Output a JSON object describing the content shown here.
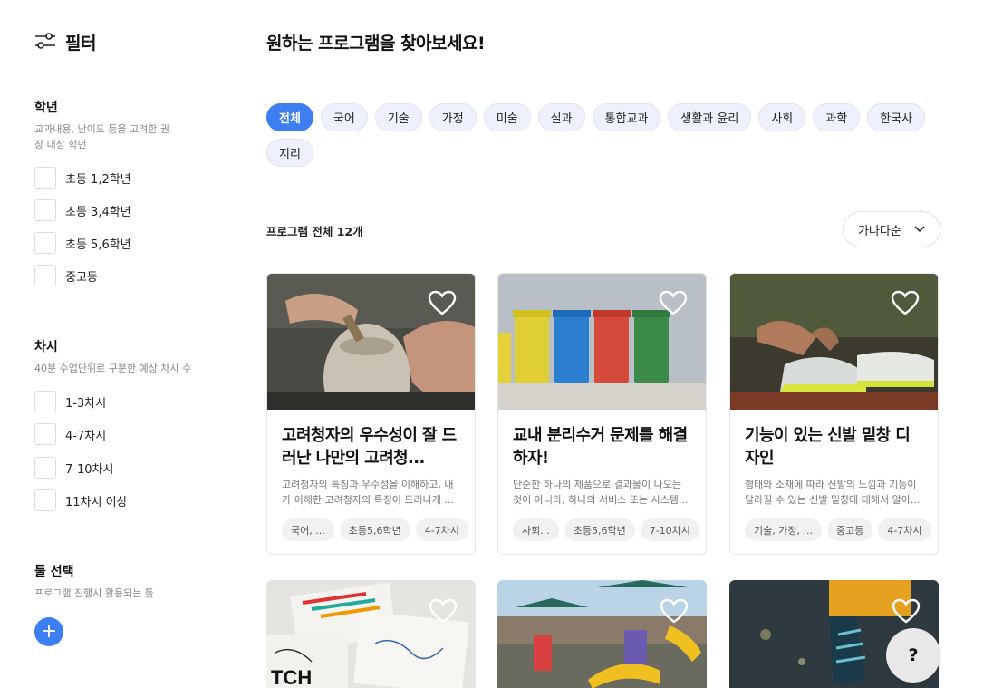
{
  "sidebar": {
    "title": "필터",
    "sections": [
      {
        "title": "학년",
        "desc": "교과내용, 난이도 등을 고려한 권장 대상 학년",
        "options": [
          "초등 1,2학년",
          "초등 3,4학년",
          "초등 5,6학년",
          "중고등"
        ]
      },
      {
        "title": "차시",
        "desc": "40분 수업단위로 구분한 예상 차시 수",
        "options": [
          "1-3차시",
          "4-7차시",
          "7-10차시",
          "11차시 이상"
        ]
      },
      {
        "title": "툴 선택",
        "desc": "프로그램 진행시 활용되는 툴",
        "options": []
      }
    ],
    "add_label": "+"
  },
  "main": {
    "title": "원하는 프로그램을 찾아보세요!",
    "chips": [
      "전체",
      "국어",
      "기술",
      "가정",
      "미술",
      "실과",
      "통합교과",
      "생활과 윤리",
      "사회",
      "과학",
      "한국사",
      "지리"
    ],
    "active_chip": "전체",
    "count_label": "프로그램 전체 12개",
    "sort_label": "가나다순",
    "cards": [
      {
        "title": "고려청자의 우수성이 잘 드러난 나만의 고려청...",
        "desc": "고려청자의 특징과 우수성을 이해하고, 내가 이해한 고려청자의 특징이 드러나게 ...",
        "tags": [
          "국어, ...",
          "초등5,6학년",
          "4-7차시"
        ]
      },
      {
        "title": "교내 분리수거 문제를 해결하자!",
        "desc": "단순한 하나의 제품으로 결과물이 나오는 것이 아니라, 하나의 서비스 또는 시스템...",
        "tags": [
          "사회...",
          "초등5,6학년",
          "7-10차시"
        ]
      },
      {
        "title": "기능이 있는 신발 밑창 디자인",
        "desc": "형태와 소재에 따라 신발의 느낌과 기능이 달라질 수 있는 신발 밑창에 대해서 알아...",
        "tags": [
          "기술, 가정, ...",
          "중고등",
          "4-7차시"
        ]
      }
    ],
    "help_label": "?"
  },
  "colors": {
    "accent": "#3d7ef0",
    "chip_bg": "#eef1fb"
  }
}
